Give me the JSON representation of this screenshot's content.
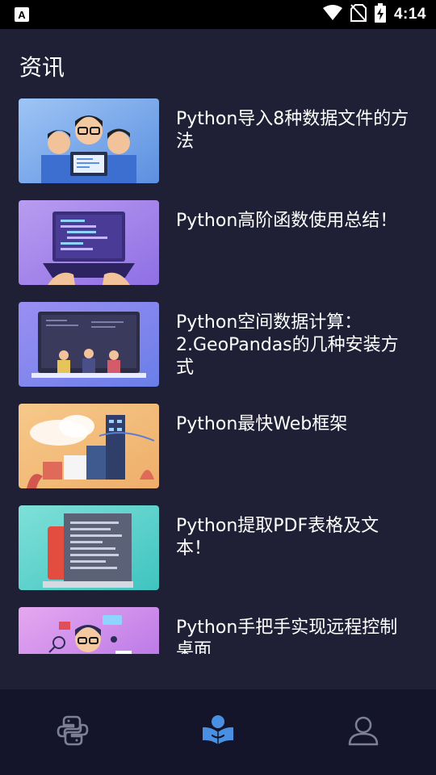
{
  "status_bar": {
    "time": "4:14",
    "icons": [
      "app-notification-icon",
      "wifi-icon",
      "no-sim-icon",
      "battery-charging-icon"
    ]
  },
  "page": {
    "title": "资讯"
  },
  "news": [
    {
      "title": "Python导入8种数据文件的方法",
      "thumb_icon": "team-illustration"
    },
    {
      "title": "Python高阶函数使用总结！",
      "thumb_icon": "laptop-code-illustration"
    },
    {
      "title": "Python空间数据计算：2.GeoPandas的几种安装方式",
      "thumb_icon": "developers-screen-illustration"
    },
    {
      "title": "Python最快Web框架",
      "thumb_icon": "cloud-city-illustration"
    },
    {
      "title": "Python提取PDF表格及文本！",
      "thumb_icon": "document-illustration"
    },
    {
      "title": "Python手把手实现远程控制桌面",
      "thumb_icon": "developer-person-illustration"
    }
  ],
  "bottom_nav": [
    {
      "name": "python",
      "icon": "python-logo-icon",
      "active": false
    },
    {
      "name": "news",
      "icon": "reader-book-icon",
      "active": true
    },
    {
      "name": "profile",
      "icon": "user-profile-icon",
      "active": false
    }
  ],
  "colors": {
    "background": "#1f2035",
    "bottom_nav": "#14152a",
    "active": "#4a90e2",
    "inactive": "#7c7f95"
  }
}
